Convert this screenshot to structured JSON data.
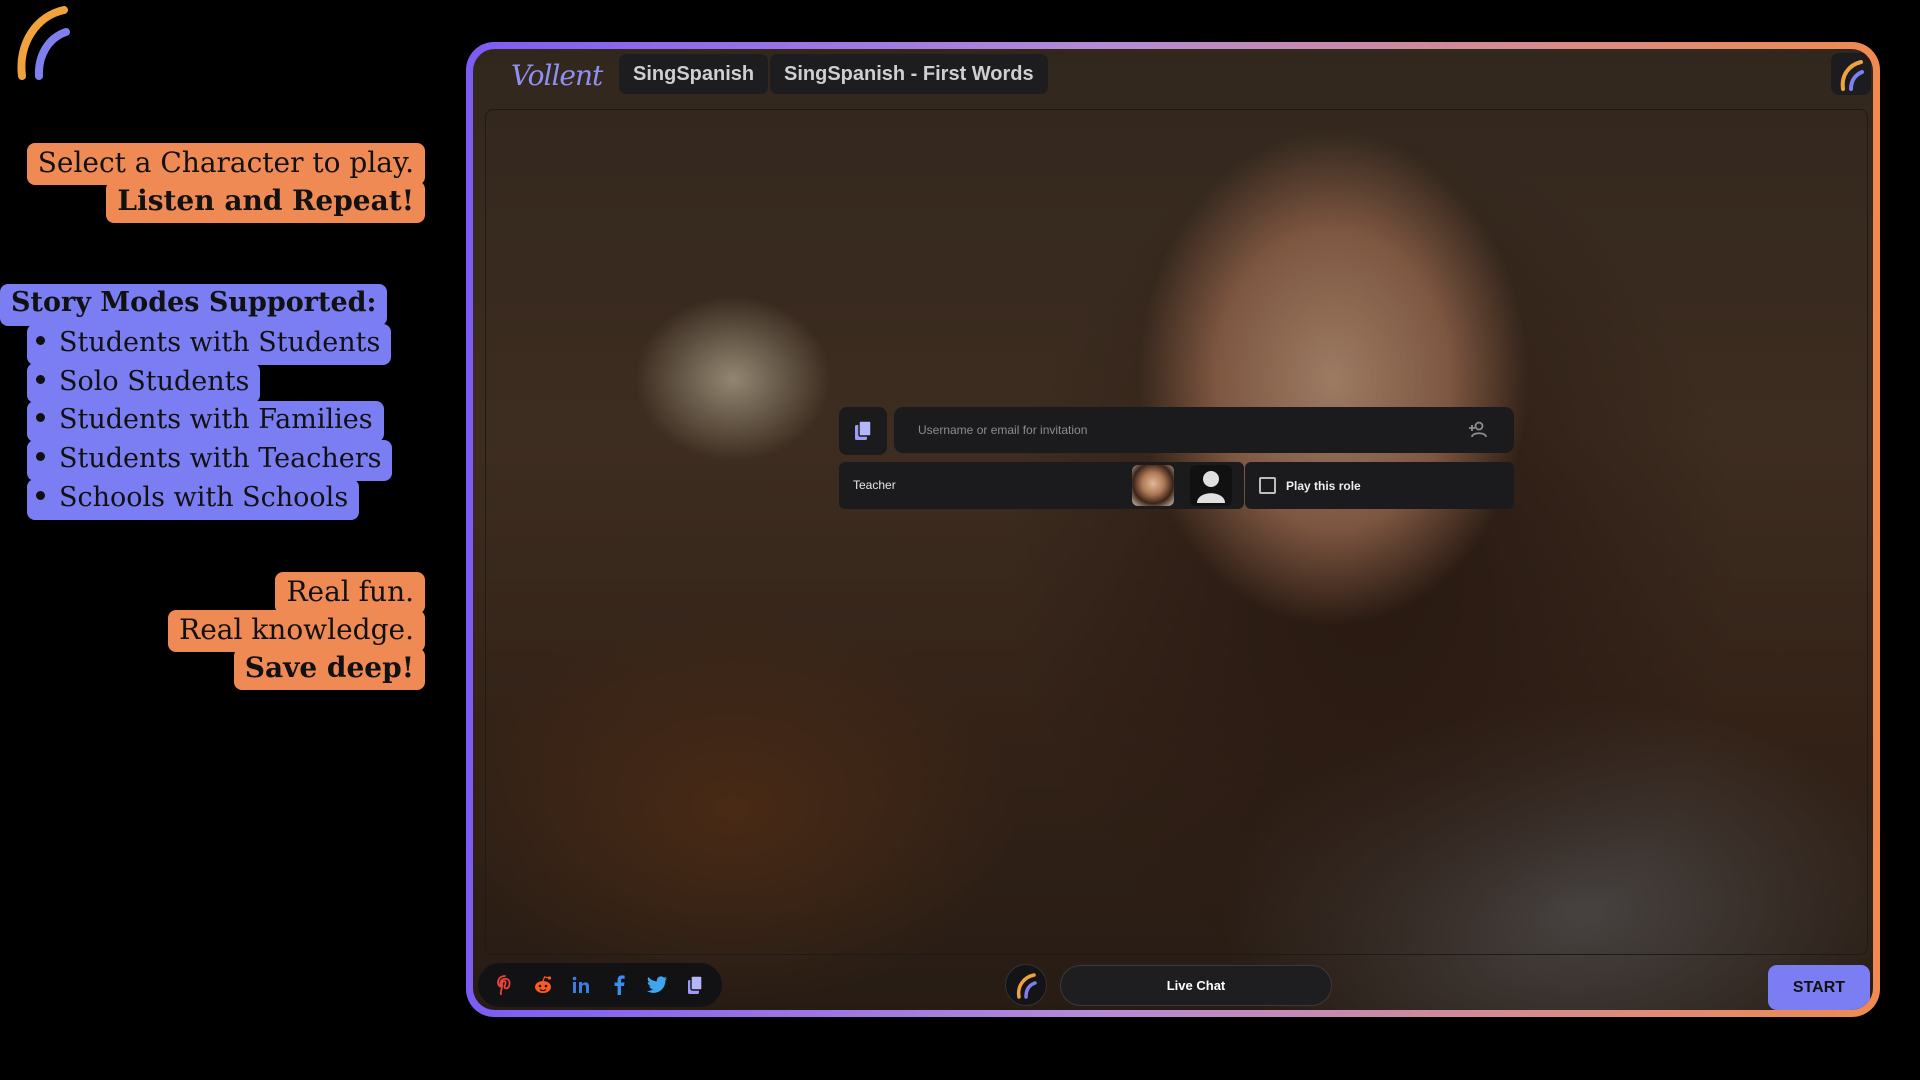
{
  "callouts": {
    "select_line": "Select a Character to play.",
    "listen_line": "Listen and Repeat!",
    "modes_heading": "Story Modes Supported:",
    "modes": [
      "Students with Students",
      "Solo Students",
      "Students with Families",
      "Students with Teachers",
      "Schools with Schools"
    ],
    "fun_line": "Real fun.",
    "knowledge_line": "Real knowledge.",
    "save_line": "Save deep!"
  },
  "app": {
    "brand": "Vollent",
    "tabs": [
      "SingSpanish",
      "SingSpanish - First Words"
    ]
  },
  "invite": {
    "placeholder": "Username or email for invitation"
  },
  "role": {
    "name": "Teacher",
    "play_label": "Play this role"
  },
  "bottom": {
    "share_icons": [
      "pinterest-icon",
      "reddit-icon",
      "linkedin-icon",
      "facebook-icon",
      "twitter-icon",
      "copy-icon"
    ],
    "live_chat_label": "Live Chat",
    "start_label": "START"
  },
  "colors": {
    "accent_violet": "#7b7ef2",
    "accent_orange": "#ef8a55"
  }
}
